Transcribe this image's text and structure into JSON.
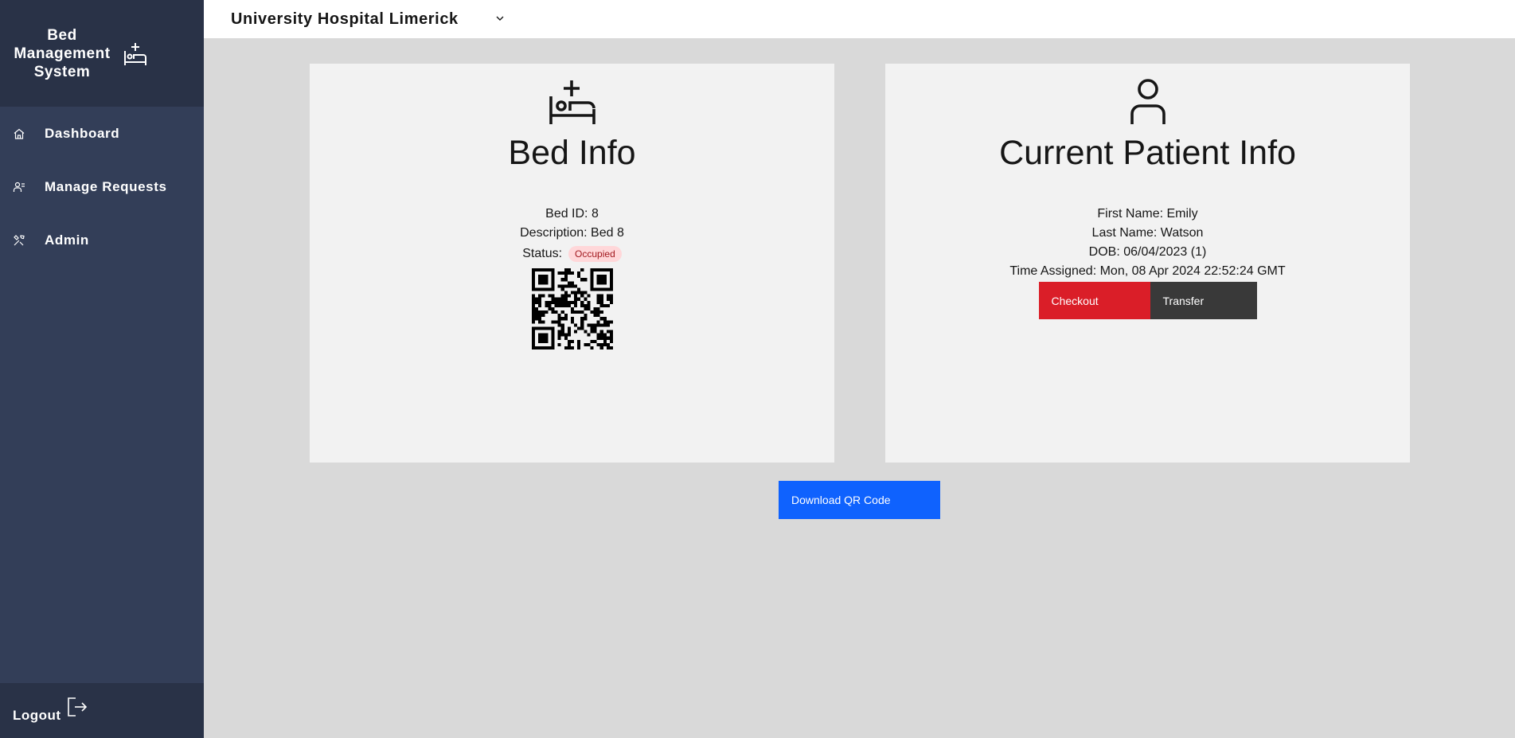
{
  "app": {
    "title_lines": [
      "Bed",
      "Management",
      "System"
    ]
  },
  "sidebar": {
    "items": [
      {
        "label": "Dashboard",
        "icon": "home-icon"
      },
      {
        "label": "Manage Requests",
        "icon": "user-requests-icon"
      },
      {
        "label": "Admin",
        "icon": "tools-icon"
      }
    ],
    "logout_label": "Logout"
  },
  "header": {
    "hospital": "University Hospital Limerick"
  },
  "bed_card": {
    "title": "Bed Info",
    "bed_id": "Bed ID: 8",
    "description": "Description: Bed 8",
    "status_label": "Status:",
    "status_value": "Occupied"
  },
  "patient_card": {
    "title": "Current Patient Info",
    "first_name": "First Name: Emily",
    "last_name": "Last Name: Watson",
    "dob": "DOB: 06/04/2023 (1)",
    "time_assigned": "Time Assigned: Mon, 08 Apr 2024 22:52:24 GMT",
    "checkout_label": "Checkout",
    "transfer_label": "Transfer"
  },
  "actions": {
    "download_label": "Download QR Code"
  },
  "colors": {
    "sidebar": "#333e58",
    "sidebar_dark": "#293247",
    "danger": "#da1e28",
    "primary": "#0f62fe",
    "secondary": "#393939"
  }
}
